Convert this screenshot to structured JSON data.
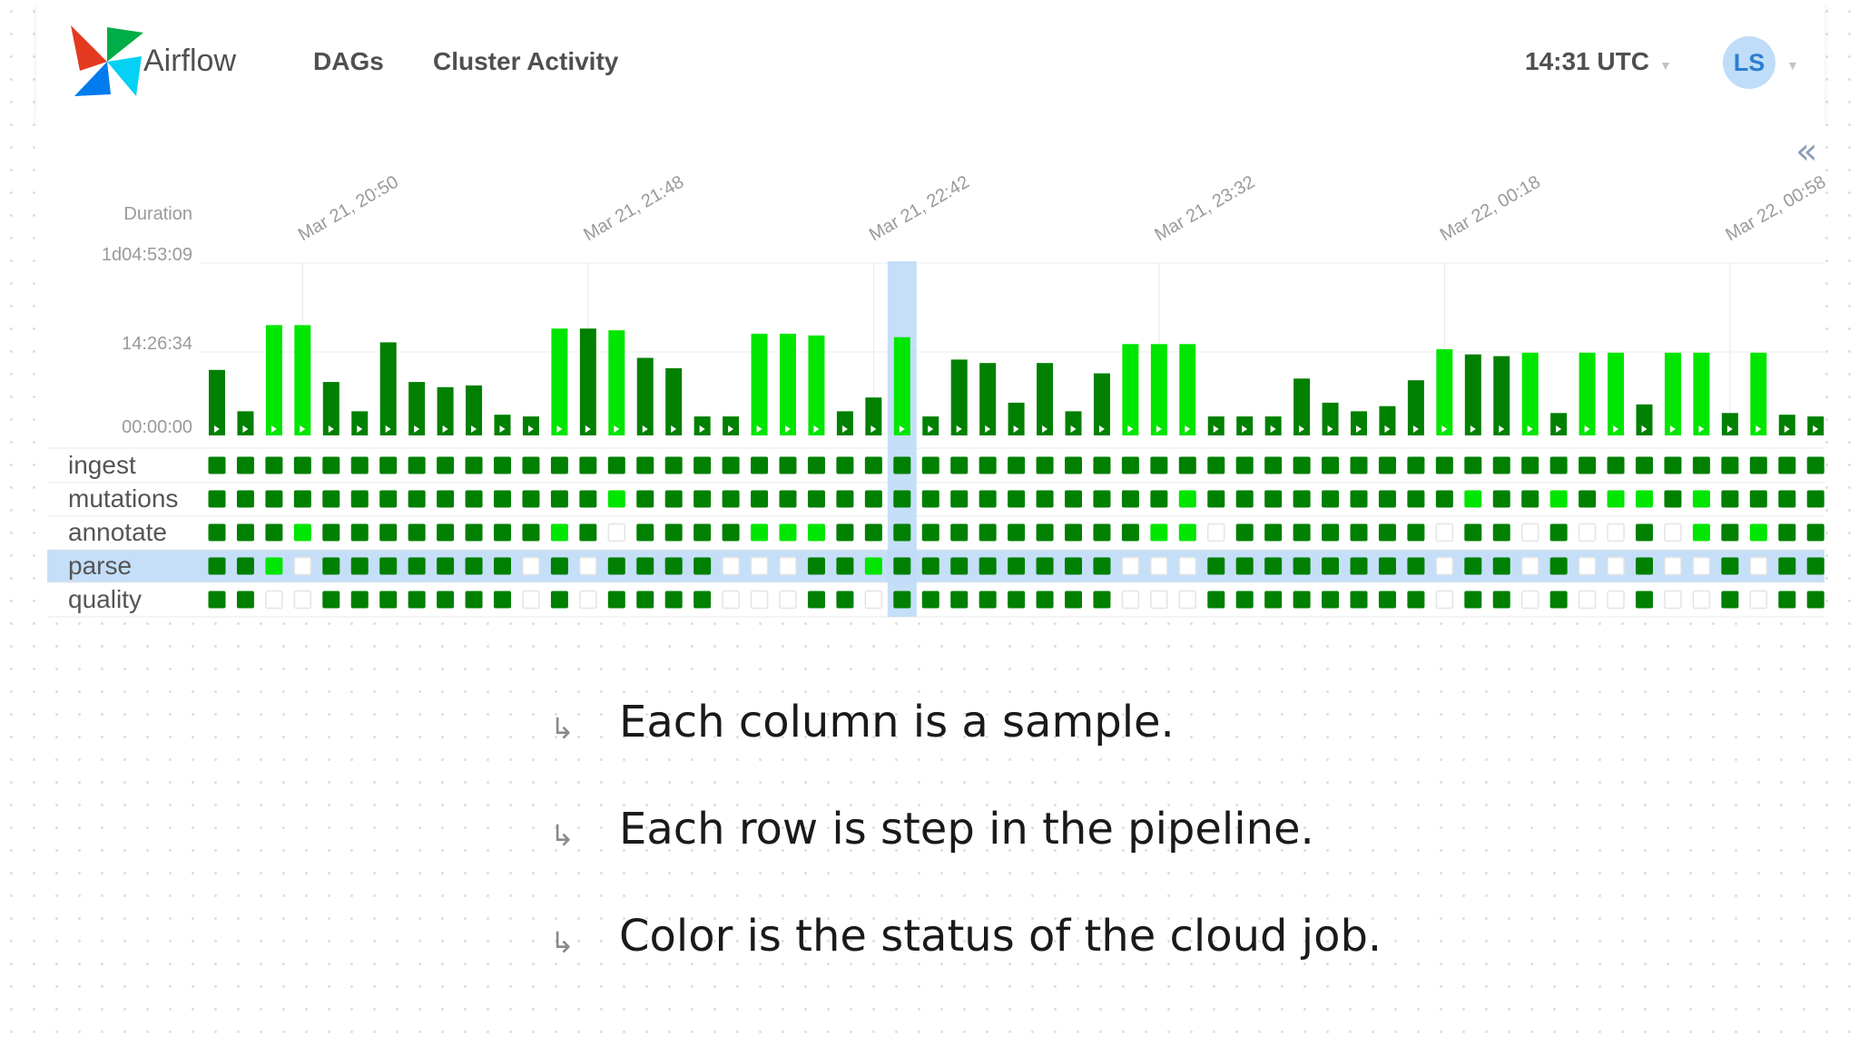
{
  "navbar": {
    "brand": "Airflow",
    "links": [
      "DAGs",
      "Cluster Activity"
    ],
    "time": "14:31 UTC",
    "user_initials": "LS"
  },
  "colors": {
    "success": "#008000",
    "success_light": "#00e600",
    "highlight": "#bfdcf8",
    "empty_border": "#e4e4e4"
  },
  "chart_data": {
    "type": "bar",
    "ylabel": "Duration",
    "y_ticks": [
      "1d04:53:09",
      "14:26:34",
      "00:00:00"
    ],
    "x_ticks": [
      "Mar 21, 20:50",
      "Mar 21, 21:48",
      "Mar 21, 22:42",
      "Mar 21, 23:32",
      "Mar 22, 00:18",
      "Mar 22, 00:58"
    ],
    "x_tick_at": [
      3,
      13,
      23,
      33,
      43,
      53
    ],
    "selected_index": 24,
    "duration_fraction": [
      0.38,
      0.14,
      0.64,
      0.64,
      0.31,
      0.14,
      0.54,
      0.31,
      0.28,
      0.29,
      0.12,
      0.11,
      0.62,
      0.62,
      0.61,
      0.45,
      0.39,
      0.11,
      0.11,
      0.59,
      0.59,
      0.58,
      0.14,
      0.22,
      0.57,
      0.11,
      0.44,
      0.42,
      0.19,
      0.42,
      0.14,
      0.36,
      0.53,
      0.53,
      0.53,
      0.11,
      0.11,
      0.11,
      0.33,
      0.19,
      0.14,
      0.17,
      0.32,
      0.5,
      0.47,
      0.46,
      0.48,
      0.13,
      0.48,
      0.48,
      0.18,
      0.48,
      0.48,
      0.13,
      0.48,
      0.12,
      0.11
    ],
    "bar_status": [
      "success",
      "success",
      "success_light",
      "success_light",
      "success",
      "success",
      "success",
      "success",
      "success",
      "success",
      "success",
      "success",
      "success_light",
      "success",
      "success_light",
      "success",
      "success",
      "success",
      "success",
      "success_light",
      "success_light",
      "success_light",
      "success",
      "success",
      "success_light",
      "success",
      "success",
      "success",
      "success",
      "success",
      "success",
      "success",
      "success_light",
      "success_light",
      "success_light",
      "success",
      "success",
      "success",
      "success",
      "success",
      "success",
      "success",
      "success",
      "success_light",
      "success",
      "success",
      "success_light",
      "success",
      "success_light",
      "success_light",
      "success",
      "success_light",
      "success_light",
      "success",
      "success_light",
      "success",
      "success"
    ],
    "rows": [
      {
        "task": "ingest",
        "states": "DDDDDDDDDDDDDDDDDDDDDDDDDDDDDDDDDDDDDDDDDDDDDDDDDDDDDDDDD"
      },
      {
        "task": "mutations",
        "states": "DDDDDDDDDDDDDDLDDDDDDDDDDDDDDDDDDDLDDDDDDDDDLDDLDLLDLDDDDD"
      },
      {
        "task": "annotate",
        "states": "DDDLDDDDDDDDLDEDDDDLLLDDDDDDDDDDDLLEDDDDDDDEDDEDEEDELDLDD"
      },
      {
        "task": "parse",
        "states": "DDLEDDDDDDDEDEDDDDEEEDDLDDDDDDDDEEEDDDDDDDDEDDEDEEDEEDEDD"
      },
      {
        "task": "quality",
        "states": "DDEEDDDDDDDEDEDDDDEEEDDEDDDDDDDDEEEDDDDDDDDEDDEDEEDEEDEDD"
      }
    ]
  },
  "notes": [
    {
      "icon": "return-arrow-icon",
      "text": "Each column is a sample."
    },
    {
      "icon": "return-arrow-icon",
      "text": "Each row is step in the pipeline."
    },
    {
      "icon": "return-arrow-icon",
      "text": "Color is the status of the cloud job."
    }
  ]
}
